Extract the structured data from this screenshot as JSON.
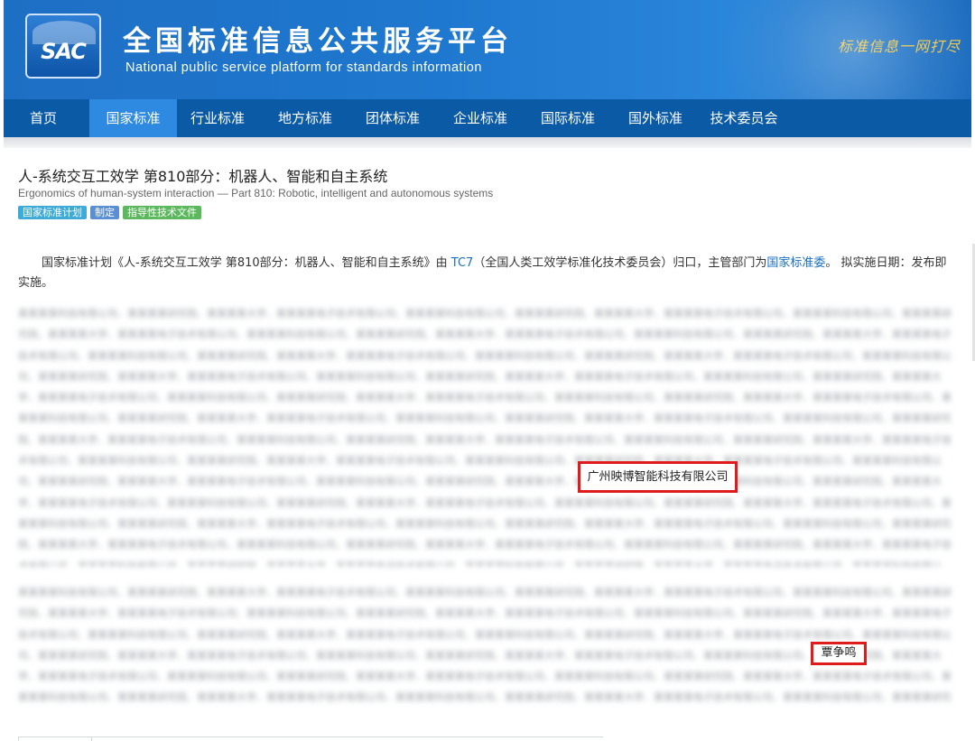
{
  "header": {
    "logo_text": "SAC",
    "title": "全国标准信息公共服务平台",
    "subtitle": "National public service platform  for standards information",
    "slogan": "标准信息一网打尽"
  },
  "nav": {
    "items": [
      {
        "label": "首页"
      },
      {
        "label": "国家标准"
      },
      {
        "label": "行业标准"
      },
      {
        "label": "地方标准"
      },
      {
        "label": "团体标准"
      },
      {
        "label": "企业标准"
      },
      {
        "label": "国际标准"
      },
      {
        "label": "国外标准"
      },
      {
        "label": "技术委员会"
      }
    ],
    "active": "国家标准"
  },
  "standard": {
    "title": "人-系统交互工效学 第810部分：机器人、智能和自主系统",
    "title_en": "Ergonomics of human-system interaction — Part 810: Robotic, intelligent and autonomous systems",
    "tags": [
      "国家标准计划",
      "制定",
      "指导性技术文件"
    ]
  },
  "description": {
    "part1": "国家标准计划《人-系统交互工效学 第810部分：机器人、智能和自主系统》由 ",
    "tc_link": "TC7",
    "part2": "（全国人类工效学标准化技术委员会）归口，主管部门为",
    "dept_link": "国家标准委",
    "part3": "。 拟实施日期：发布即实施。"
  },
  "drafting_units": {
    "highlighted": "广州映博智能科技有限公司"
  },
  "drafters": {
    "highlighted": "覃争鸣"
  },
  "colors": {
    "banner": "#1f78cf",
    "nav": "#0b5aa5",
    "nav_active": "#2d8ae0",
    "highlight_border": "#e01b1b",
    "link": "#1a6fc4"
  }
}
